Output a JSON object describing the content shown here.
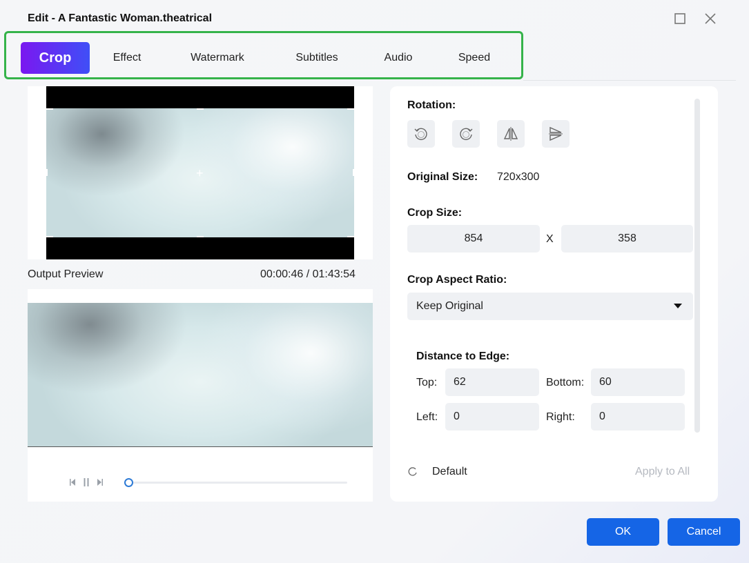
{
  "window": {
    "title": "Edit - A Fantastic Woman.theatrical"
  },
  "tabs": [
    {
      "label": "Crop",
      "active": true
    },
    {
      "label": "Effect"
    },
    {
      "label": "Watermark"
    },
    {
      "label": "Subtitles"
    },
    {
      "label": "Audio"
    },
    {
      "label": "Speed"
    }
  ],
  "preview": {
    "output_label": "Output Preview",
    "time": "00:00:46 / 01:43:54",
    "progress_fraction": 0.02
  },
  "panel": {
    "rotation_label": "Rotation:",
    "rotation_buttons": [
      "rotate-left-90-icon",
      "rotate-right-90-icon",
      "flip-horizontal-icon",
      "flip-vertical-icon"
    ],
    "original_size_label": "Original Size:",
    "original_size_value": "720x300",
    "crop_size_label": "Crop Size:",
    "crop_width": "854",
    "crop_x": "X",
    "crop_height": "358",
    "aspect_label": "Crop Aspect Ratio:",
    "aspect_value": "Keep Original",
    "distance_label": "Distance to Edge:",
    "top_label": "Top:",
    "top_value": "62",
    "bottom_label": "Bottom:",
    "bottom_value": "60",
    "left_label": "Left:",
    "left_value": "0",
    "right_label": "Right:",
    "right_value": "0",
    "default_label": "Default",
    "apply_all_label": "Apply to All"
  },
  "footer": {
    "ok_label": "OK",
    "cancel_label": "Cancel"
  },
  "colors": {
    "accent": "#1565e6",
    "tab_gradient_start": "#7a18f0",
    "tab_gradient_end": "#3f4ff7",
    "highlight_box": "#35b34a"
  }
}
